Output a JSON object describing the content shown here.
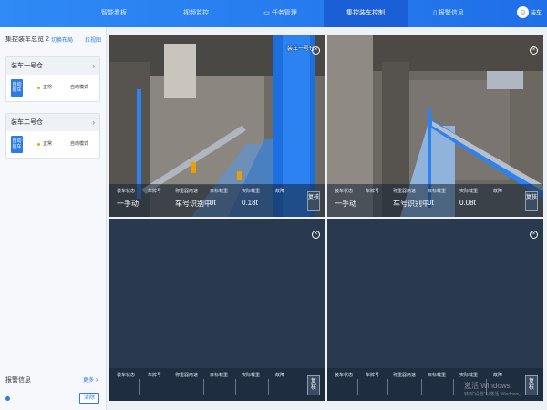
{
  "nav": {
    "items": [
      {
        "label": "智能看板"
      },
      {
        "label": "视频监控"
      },
      {
        "label": "任务管理"
      },
      {
        "label": "集控装车控制"
      },
      {
        "label": "报警信息"
      }
    ],
    "user": "装车"
  },
  "sidebar": {
    "heading": "集控装车总览 2",
    "switch_layout": "切换布局",
    "view_link": "拉视图",
    "groups": [
      {
        "title": "装车一号仓",
        "mode": "自动装车",
        "status": "正常",
        "auto": "自动模式"
      },
      {
        "title": "装车二号仓",
        "mode": "自动装车",
        "status": "正常",
        "auto": "自动模式"
      }
    ],
    "alarm": {
      "heading": "报警信息",
      "more": "更多 >",
      "reset": "清除"
    }
  },
  "panels": [
    {
      "camera": "装车一号仓",
      "fields": [
        {
          "label": "装车状态",
          "value": "一手动"
        },
        {
          "label": "车牌号",
          "value": ""
        },
        {
          "label": "称重器两速",
          "value": "车号识别中"
        },
        {
          "label": "目标载重",
          "value": "0t"
        },
        {
          "label": "实际载重",
          "value": "0.18t"
        },
        {
          "label": "故障",
          "value": ""
        }
      ],
      "review": "复核"
    },
    {
      "camera": "",
      "fields": [
        {
          "label": "装车状态",
          "value": "一手动"
        },
        {
          "label": "车牌号",
          "value": ""
        },
        {
          "label": "称重器两速",
          "value": "车号识别中"
        },
        {
          "label": "目标载重",
          "value": "0t"
        },
        {
          "label": "实际载重",
          "value": "0.08t"
        },
        {
          "label": "故障",
          "value": ""
        }
      ],
      "review": "复核"
    },
    {
      "camera": "",
      "fields": [
        {
          "label": "装车状态",
          "value": ""
        },
        {
          "label": "车牌号",
          "value": ""
        },
        {
          "label": "称重器两速",
          "value": ""
        },
        {
          "label": "目标载重",
          "value": ""
        },
        {
          "label": "实际载重",
          "value": ""
        },
        {
          "label": "故障",
          "value": ""
        }
      ],
      "review": "复 核"
    },
    {
      "camera": "",
      "fields": [
        {
          "label": "装车状态",
          "value": ""
        },
        {
          "label": "车牌号",
          "value": ""
        },
        {
          "label": "称重器两速",
          "value": ""
        },
        {
          "label": "目标载重",
          "value": ""
        },
        {
          "label": "实际载重",
          "value": ""
        },
        {
          "label": "故障",
          "value": ""
        }
      ],
      "review": "复 核"
    }
  ],
  "watermark": {
    "title": "激活 Windows",
    "sub": "转到“设置”以激活 Windows。"
  }
}
